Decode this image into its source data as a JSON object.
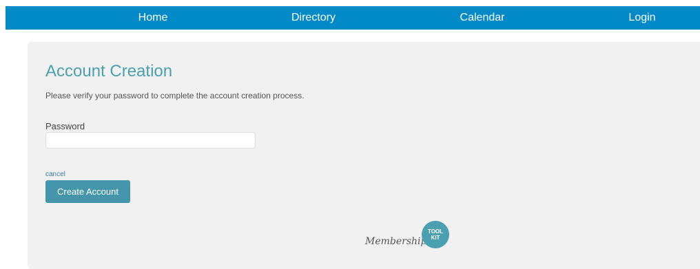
{
  "nav": {
    "items": [
      {
        "label": "Home"
      },
      {
        "label": "Directory"
      },
      {
        "label": "Calendar"
      },
      {
        "label": "Login"
      }
    ]
  },
  "main": {
    "title": "Account Creation",
    "intro": "Please verify your password to complete the account creation process.",
    "password_label": "Password",
    "password_value": "",
    "cancel_label": "cancel",
    "submit_label": "Create Account"
  },
  "footer": {
    "logo_script": "Membership",
    "logo_badge_line1": "TOOL",
    "logo_badge_line2": "KIT"
  },
  "colors": {
    "nav_bg": "#0289c8",
    "card_bg": "#f1f1f1",
    "title": "#4a9fb0",
    "button": "#4596aa",
    "link": "#3a7ca8"
  }
}
